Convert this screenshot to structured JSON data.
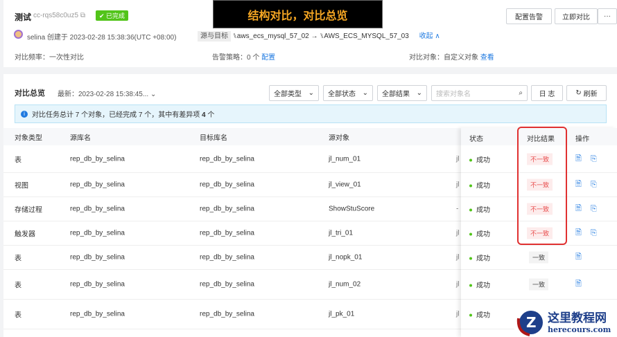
{
  "header": {
    "title": "测试",
    "task_id": "cc-rqs58c0uz5",
    "status_badge": "已完成",
    "creator": "selina 创建于 2023-02-28 15:38:36(UTC +08:00)",
    "src_target_label": "源与目标",
    "source": "aws_ecs_mysql_57_02 →",
    "target": "AWS_ECS_MYSQL_57_03",
    "collapse": "收起 ∧",
    "frequency": "对比频率：一次性对比",
    "alert": "告警策略：0 个",
    "alert_link": "配置",
    "objects": "对比对象：自定义对象",
    "objects_link": "查看",
    "btn_alert": "配置告警",
    "btn_compare": "立即对比",
    "btn_more": "···"
  },
  "banner": "结构对比，对比总览",
  "overview": {
    "title": "对比总览",
    "latest": "最新：2023-02-28 15:38:45...",
    "filter_type": "全部类型",
    "filter_status": "全部状态",
    "filter_result": "全部结果",
    "search_placeholder": "搜索对象名",
    "btn_log": "日 志",
    "btn_refresh": "刷新",
    "info_prefix": "对比任务总计 7 个对象，已经完成 7 个，其中有差异项 ",
    "info_count": "4",
    "info_suffix": " 个"
  },
  "table": {
    "headers": [
      "对象类型",
      "源库名",
      "目标库名",
      "源对象",
      "状态",
      "对比结果",
      "操作"
    ],
    "rows": [
      {
        "type": "表",
        "src_db": "rep_db_by_selina",
        "dst_db": "rep_db_by_selina",
        "obj": "jl_num_01",
        "trunc": "jl",
        "status": "成功",
        "result": "不一致",
        "diff": true
      },
      {
        "type": "视图",
        "src_db": "rep_db_by_selina",
        "dst_db": "rep_db_by_selina",
        "obj": "jl_view_01",
        "trunc": "jl",
        "status": "成功",
        "result": "不一致",
        "diff": true
      },
      {
        "type": "存储过程",
        "src_db": "rep_db_by_selina",
        "dst_db": "rep_db_by_selina",
        "obj": "ShowStuScore",
        "trunc": "-",
        "status": "成功",
        "result": "不一致",
        "diff": true
      },
      {
        "type": "触发器",
        "src_db": "rep_db_by_selina",
        "dst_db": "rep_db_by_selina",
        "obj": "jl_tri_01",
        "trunc": "jl",
        "status": "成功",
        "result": "不一致",
        "diff": true
      },
      {
        "type": "表",
        "src_db": "rep_db_by_selina",
        "dst_db": "rep_db_by_selina",
        "obj": "jl_nopk_01",
        "trunc": "jl",
        "status": "成功",
        "result": "一致",
        "diff": false
      },
      {
        "type": "表",
        "src_db": "rep_db_by_selina",
        "dst_db": "rep_db_by_selina",
        "obj": "jl_num_02",
        "trunc": "jl",
        "status": "成功",
        "result": "一致",
        "diff": false
      },
      {
        "type": "表",
        "src_db": "rep_db_by_selina",
        "dst_db": "rep_db_by_selina",
        "obj": "jl_pk_01",
        "trunc": "jl",
        "status": "成功",
        "result": "",
        "diff": false
      }
    ]
  },
  "watermark": {
    "name": "这里教程网",
    "url": "herecours.com"
  }
}
